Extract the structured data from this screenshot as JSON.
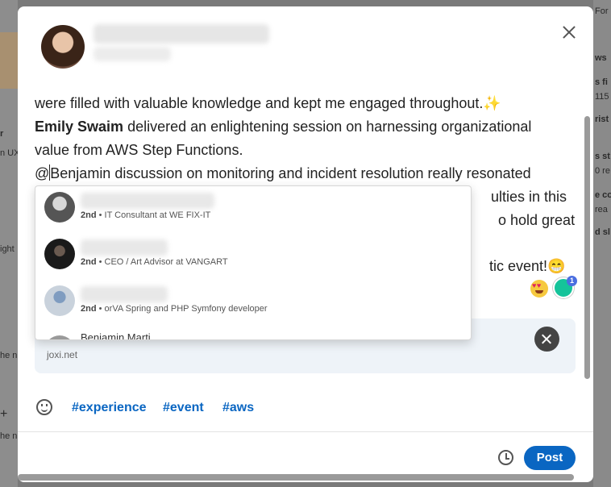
{
  "background": {
    "right_fragments": [
      "For",
      "ws",
      "s fi",
      "115",
      "rist",
      "s st",
      "0 re",
      "e co",
      "rea",
      "d sl"
    ],
    "left_fragments": [
      "r",
      "n UX",
      "ight",
      "he n",
      "+",
      "he n"
    ]
  },
  "composer": {
    "lines": {
      "l1_text": "were filled with valuable knowledge and kept me engaged throughout.",
      "l1_emoji": "✨",
      "l2_bold": "Emily Swaim",
      "l2_text": " delivered an enlightening session on harnessing organizational",
      "l3_text": "value from AWS Step Functions.",
      "l4_at": "@",
      "l4_text": "Benjamin discussion on monitoring and incident resolution really resonated",
      "l5_tail": "ulties in this",
      "l6_tail": "o hold great",
      "l7_tail": "tic event!",
      "l7_emoji": "😁"
    },
    "grammarly_count": "1"
  },
  "mention_dropdown": {
    "items": [
      {
        "degree": "2nd",
        "headline": "IT Consultant at WE FIX-IT"
      },
      {
        "degree": "2nd",
        "headline": "CEO / Art Advisor at VANGART"
      },
      {
        "degree": "2nd",
        "headline": "PHP Symfony developer",
        "partial_prefix": "• orVA Spring and"
      },
      {
        "partial_name": "Benjamin Marti..."
      }
    ]
  },
  "link_preview": {
    "domain": "joxi.net"
  },
  "hashtags": [
    "#experience",
    "#event",
    "#aws"
  ],
  "footer": {
    "post_label": "Post"
  },
  "colors": {
    "accent": "#0a66c2",
    "link_card_bg": "#eef3f8"
  }
}
